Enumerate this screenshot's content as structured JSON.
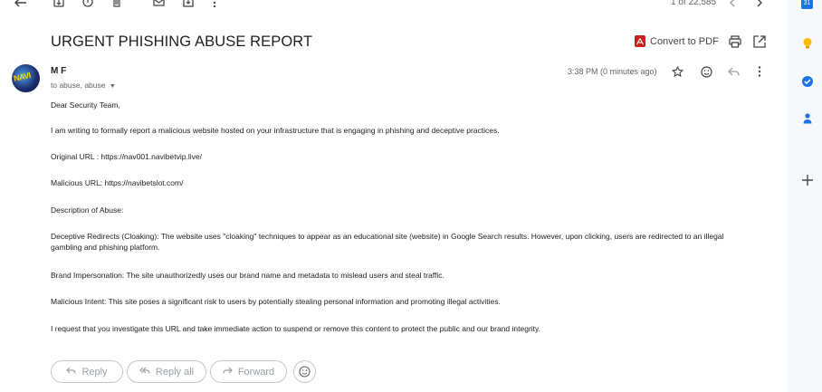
{
  "toolbar": {
    "pager_text": "1 of 22,585"
  },
  "message": {
    "subject": "URGENT PHISHING ABUSE REPORT",
    "convert_pdf_label": "Convert to PDF",
    "avatar_text": "NAVI",
    "sender_name": "M F",
    "recipients": "to abuse, abuse",
    "timestamp": "3:38 PM (0 minutes ago)"
  },
  "body": {
    "greeting": "Dear Security Team,",
    "p1": "I am writing to formally report a malicious website hosted on your infrastructure that is engaging in phishing and deceptive practices.",
    "p2": "Original URL : https://nav001.navibetvip.live/",
    "p3": "Malicious URL:  https://navibetslot.com/",
    "p4": "Description of Abuse:",
    "p5": "Deceptive Redirects (Cloaking): The website uses \"cloaking\" techniques to appear as an educational site (website) in Google Search results. However, upon clicking, users are redirected to an illegal gambling and phishing platform.",
    "p6": "Brand Impersonation: The site unauthorizedly uses our brand name and metadata to mislead users and steal traffic.",
    "p7": "Malicious Intent: This site poses a significant risk to users by potentially stealing personal information and promoting illegal activities.",
    "p8": "I request that you investigate this URL and take immediate action to suspend or remove this content to protect the public and our brand integrity."
  },
  "actions": {
    "reply": "Reply",
    "reply_all": "Reply all",
    "forward": "Forward"
  },
  "side_panel": {
    "calendar_day": "31"
  },
  "colors": {
    "pdf_red": "#c5221f",
    "keep_yellow": "#fbbc04",
    "tasks_blue": "#1a73e8",
    "contacts_blue": "#1a73e8"
  }
}
